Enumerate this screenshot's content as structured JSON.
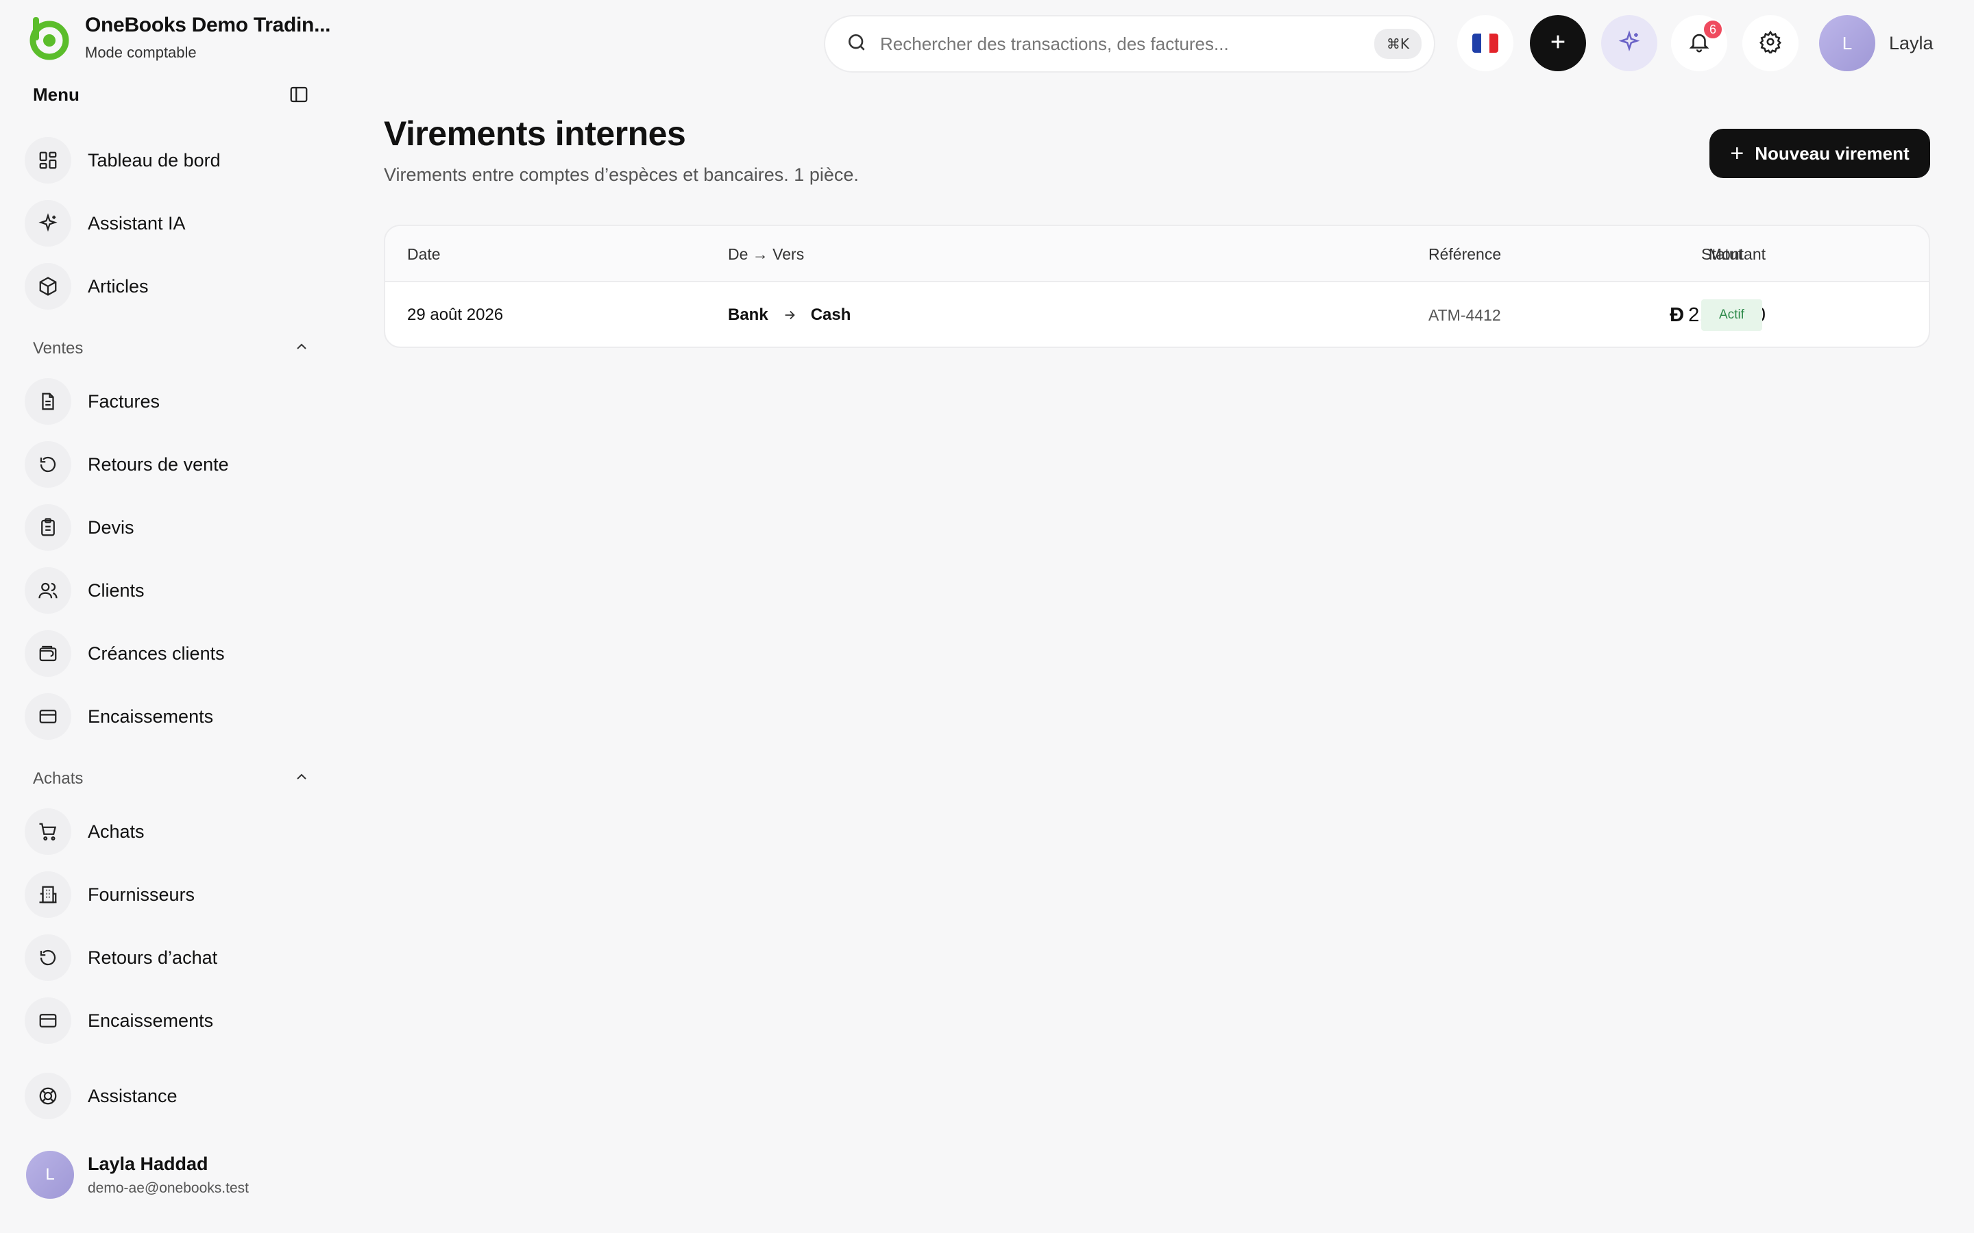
{
  "app": {
    "company_name": "OneBooks Demo Tradin...",
    "mode": "Mode comptable",
    "brand_color": "#5bbd2b"
  },
  "sidebar": {
    "menu_title": "Menu",
    "top_items": [
      {
        "label": "Tableau de bord",
        "icon": "dashboard-icon"
      },
      {
        "label": "Assistant IA",
        "icon": "sparkles-icon"
      },
      {
        "label": "Articles",
        "icon": "package-icon"
      }
    ],
    "sections": [
      {
        "title": "Ventes",
        "items": [
          {
            "label": "Factures",
            "icon": "document-icon"
          },
          {
            "label": "Retours de vente",
            "icon": "return-icon"
          },
          {
            "label": "Devis",
            "icon": "clipboard-icon"
          },
          {
            "label": "Clients",
            "icon": "users-icon"
          },
          {
            "label": "Créances clients",
            "icon": "wallet-icon"
          },
          {
            "label": "Encaissements",
            "icon": "credit-card-icon"
          }
        ]
      },
      {
        "title": "Achats",
        "items": [
          {
            "label": "Achats",
            "icon": "cart-icon"
          },
          {
            "label": "Fournisseurs",
            "icon": "building-icon"
          },
          {
            "label": "Retours d’achat",
            "icon": "return-icon"
          },
          {
            "label": "Encaissements",
            "icon": "credit-card-icon"
          }
        ]
      }
    ],
    "support_item": {
      "label": "Assistance",
      "icon": "lifebuoy-icon"
    },
    "user": {
      "initial": "L",
      "name": "Layla Haddad",
      "email": "demo-ae@onebooks.test"
    }
  },
  "topbar": {
    "search_placeholder": "Rechercher des transactions, des factures...",
    "shortcut": "⌘K",
    "language": "fr",
    "notifications_count": "6",
    "user_initial": "L",
    "user_name": "Layla"
  },
  "page": {
    "title": "Virements internes",
    "subtitle": "Virements entre comptes d’espèces et bancaires. 1 pièce.",
    "new_button_label": "Nouveau virement"
  },
  "table": {
    "columns": {
      "date": "Date",
      "route": "De → Vers",
      "amount": "Montant",
      "reference": "Référence",
      "status": "Statut"
    },
    "rows": [
      {
        "date": "29 août 2026",
        "from": "Bank",
        "to": "Cash",
        "currency": "Đ",
        "amount": "2,000.00",
        "reference": "ATM-4412",
        "status": "Actif"
      }
    ]
  }
}
